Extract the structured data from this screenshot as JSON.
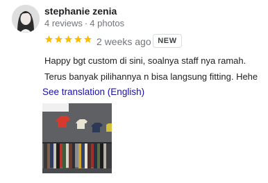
{
  "reviewer": {
    "name": "stephanie zenia",
    "reviews_count": "4 reviews",
    "photos_count": "4 photos",
    "separator": "·"
  },
  "review": {
    "rating": 5,
    "max_rating": 5,
    "star_color": "#fbbc04",
    "time": "2 weeks ago",
    "badge": "NEW",
    "lines": [
      "Happy bgt custom di sini, soalnya staff nya ramah.",
      "Terus banyak pilihannya n bisa langsung fitting. Hehe"
    ],
    "translation_link": "See translation (English)",
    "link_color": "#1a0dab"
  }
}
